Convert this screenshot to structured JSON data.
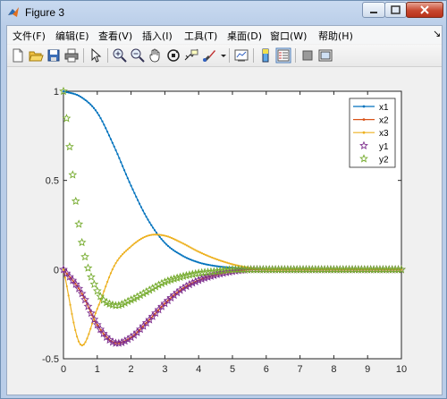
{
  "window": {
    "title": "Figure 3"
  },
  "menu": [
    "文件(F)",
    "编辑(E)",
    "查看(V)",
    "插入(I)",
    "工具(T)",
    "桌面(D)",
    "窗口(W)",
    "帮助(H)"
  ],
  "toolbar": [
    "new-file-icon",
    "open-folder-icon",
    "save-icon",
    "print-icon",
    "pointer-icon",
    "zoom-in-icon",
    "zoom-out-icon",
    "pan-icon",
    "rotate-3d-icon",
    "data-cursor-icon",
    "brush-icon",
    "link-plot-icon",
    "colorbar-icon",
    "legend-icon",
    "hide-plot-tools-icon",
    "show-plot-tools-icon"
  ],
  "colors": {
    "x1": "#0072BD",
    "x2": "#D95319",
    "x3": "#EDB120",
    "y1": "#7E2F8E",
    "y2": "#77AC30"
  },
  "chart_data": {
    "type": "line",
    "xlim": [
      0,
      10
    ],
    "ylim": [
      -0.5,
      1
    ],
    "xticks": [
      "0",
      "1",
      "2",
      "3",
      "4",
      "5",
      "6",
      "7",
      "8",
      "9",
      "10"
    ],
    "yticks": [
      "-0.5",
      "0",
      "0.5",
      "1"
    ],
    "grid": false,
    "legend_position": "top-right",
    "legend": [
      "x1",
      "x2",
      "x3",
      "y1",
      "y2"
    ],
    "x": [
      0,
      0.5,
      1,
      1.5,
      2,
      2.5,
      3,
      3.5,
      4,
      4.5,
      5,
      5.5,
      6,
      7,
      8,
      9,
      10
    ],
    "series": [
      {
        "name": "x1",
        "marker": "dot-line",
        "values": [
          1.0,
          0.97,
          0.88,
          0.69,
          0.47,
          0.28,
          0.15,
          0.08,
          0.04,
          0.02,
          0.01,
          0.005,
          0,
          0,
          0,
          0,
          0
        ]
      },
      {
        "name": "x2",
        "marker": "dot-line",
        "values": [
          0,
          -0.12,
          -0.31,
          -0.41,
          -0.38,
          -0.29,
          -0.19,
          -0.11,
          -0.06,
          -0.03,
          -0.01,
          0,
          0,
          0,
          0,
          0,
          0
        ]
      },
      {
        "name": "x3",
        "marker": "dot-line",
        "values": [
          0,
          -0.42,
          -0.22,
          0.02,
          0.13,
          0.19,
          0.19,
          0.15,
          0.1,
          0.06,
          0.03,
          0.01,
          0,
          0,
          0,
          0,
          0
        ]
      },
      {
        "name": "y1",
        "marker": "star",
        "values": [
          0,
          -0.12,
          -0.31,
          -0.41,
          -0.38,
          -0.29,
          -0.19,
          -0.11,
          -0.06,
          -0.03,
          -0.01,
          0,
          0,
          0,
          0,
          0,
          0
        ]
      },
      {
        "name": "y2",
        "marker": "star",
        "values": [
          1.0,
          0.2,
          -0.12,
          -0.2,
          -0.17,
          -0.12,
          -0.07,
          -0.04,
          -0.02,
          -0.01,
          0,
          0,
          0,
          0,
          0,
          0,
          0
        ]
      }
    ]
  }
}
